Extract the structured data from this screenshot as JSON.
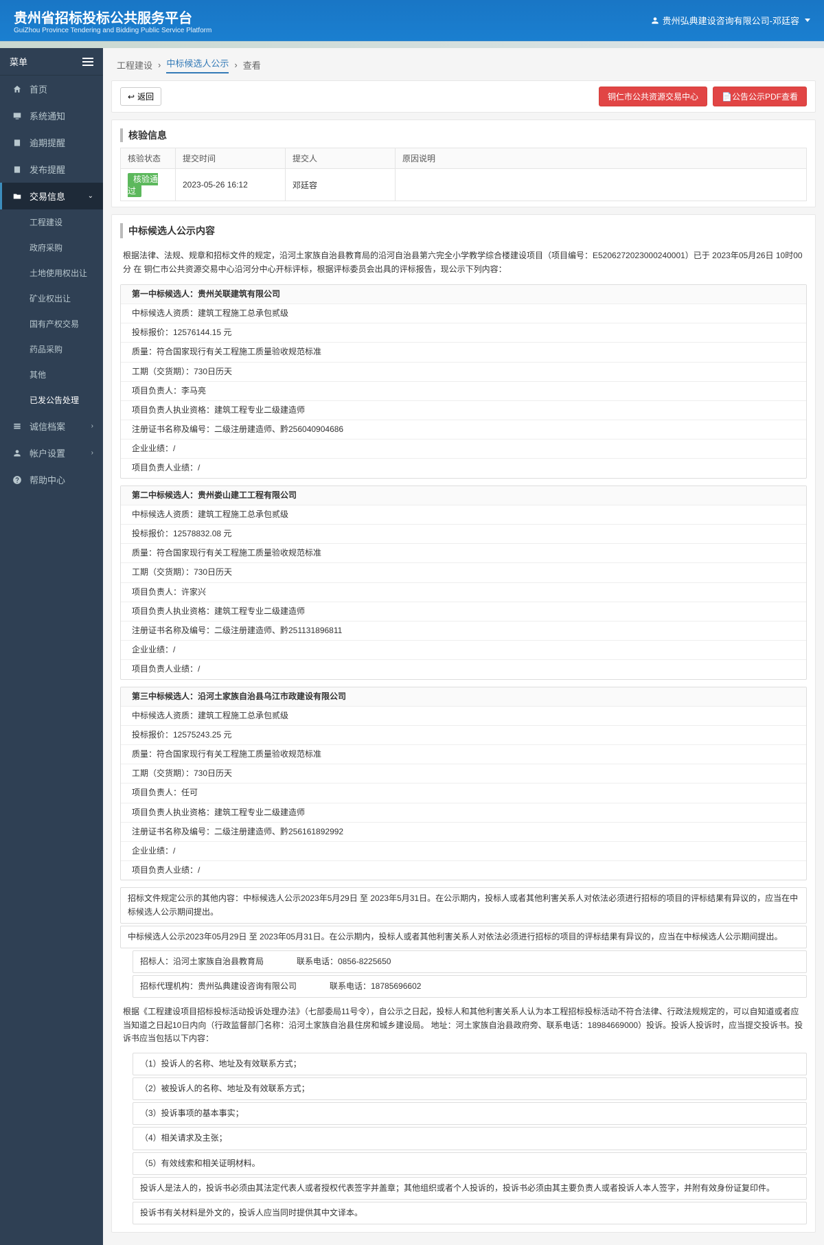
{
  "header": {
    "title_zh": "贵州省招标投标公共服务平台",
    "title_en": "GuiZhou Province Tendering and Bidding Public Service Platform",
    "user_label": "贵州弘典建设咨询有限公司-邓廷容"
  },
  "sidebar": {
    "menu_label": "菜单",
    "items": [
      {
        "label": "首页",
        "icon": "home-icon"
      },
      {
        "label": "系统通知",
        "icon": "monitor-icon"
      },
      {
        "label": "逾期提醒",
        "icon": "calendar-icon"
      },
      {
        "label": "发布提醒",
        "icon": "calendar-icon"
      },
      {
        "label": "交易信息",
        "icon": "folder-icon",
        "active": true,
        "expanded": true
      },
      {
        "label": "诚信档案",
        "icon": "list-icon",
        "chev": true
      },
      {
        "label": "帐户设置",
        "icon": "user-icon",
        "chev": true
      },
      {
        "label": "帮助中心",
        "icon": "help-icon"
      }
    ],
    "sub_items": [
      {
        "label": "工程建设"
      },
      {
        "label": "政府采购"
      },
      {
        "label": "土地使用权出让"
      },
      {
        "label": "矿业权出让"
      },
      {
        "label": "国有产权交易"
      },
      {
        "label": "药品采购"
      },
      {
        "label": "其他"
      },
      {
        "label": "已发公告处理",
        "current": true
      }
    ]
  },
  "breadcrumb": {
    "a": "工程建设",
    "b": "中标候选人公示",
    "c": "查看"
  },
  "toolbar": {
    "back": "返回",
    "center": "铜仁市公共资源交易中心",
    "pdf": "公告公示PDF查看"
  },
  "verify": {
    "section": "核验信息",
    "headers": {
      "status": "核验状态",
      "time": "提交时间",
      "person": "提交人",
      "reason": "原因说明"
    },
    "row": {
      "status": "核验通过",
      "time": "2023-05-26 16:12",
      "person": "邓廷容",
      "reason": ""
    }
  },
  "announcement": {
    "section": "中标候选人公示内容",
    "intro": "根据法律、法规、规章和招标文件的规定，沿河土家族自治县教育局的沿河自治县第六完全小学教学综合楼建设项目（项目编号：E5206272023000240001）已于 2023年05月26日 10时00分 在 铜仁市公共资源交易中心沿河分中心开标评标，根据评标委员会出具的评标报告，现公示下列内容：",
    "candidates": [
      {
        "head": "第一中标候选人：贵州关联建筑有限公司",
        "rows": [
          "中标候选人资质：建筑工程施工总承包贰级",
          "投标报价：12576144.15 元",
          "质量：符合国家现行有关工程施工质量验收规范标准",
          "工期（交货期）：730日历天",
          "项目负责人：李马亮",
          "项目负责人执业资格：建筑工程专业二级建造师",
          "注册证书名称及编号：二级注册建造师、黔256040904686",
          "企业业绩：/",
          "项目负责人业绩：/"
        ]
      },
      {
        "head": "第二中标候选人：贵州娄山建工工程有限公司",
        "rows": [
          "中标候选人资质：建筑工程施工总承包贰级",
          "投标报价：12578832.08 元",
          "质量：符合国家现行有关工程施工质量验收规范标准",
          "工期（交货期）：730日历天",
          "项目负责人：许家兴",
          "项目负责人执业资格：建筑工程专业二级建造师",
          "注册证书名称及编号：二级注册建造师、黔251131896811",
          "企业业绩：/",
          "项目负责人业绩：/"
        ]
      },
      {
        "head": "第三中标候选人：沿河土家族自治县乌江市政建设有限公司",
        "rows": [
          "中标候选人资质：建筑工程施工总承包贰级",
          "投标报价：12575243.25 元",
          "质量：符合国家现行有关工程施工质量验收规范标准",
          "工期（交货期）：730日历天",
          "项目负责人：任可",
          "项目负责人执业资格：建筑工程专业二级建造师",
          "注册证书名称及编号：二级注册建造师、黔256161892992",
          "企业业绩：/",
          "项目负责人业绩：/"
        ]
      }
    ],
    "footer": [
      "招标文件规定公示的其他内容：中标候选人公示2023年5月29日 至 2023年5月31日。在公示期内，投标人或者其他利害关系人对依法必须进行招标的项目的评标结果有异议的，应当在中标候选人公示期间提出。",
      "中标候选人公示2023年05月29日 至 2023年05月31日。在公示期内，投标人或者其他利害关系人对依法必须进行招标的项目的评标结果有异议的，应当在中标候选人公示期间提出。"
    ],
    "contacts": [
      "招标人：沿河土家族自治县教育局　　　　联系电话：0856-8225650",
      "招标代理机构：贵州弘典建设咨询有限公司　　　　联系电话：18785696602"
    ],
    "complaint_intro": "根据《工程建设项目招标投标活动投诉处理办法》（七部委局11号令），自公示之日起，投标人和其他利害关系人认为本工程招标投标活动不符合法律、行政法规规定的，可以自知道或者应当知道之日起10日内向（行政监督部门名称：沿河土家族自治县住房和城乡建设局。 地址：河土家族自治县政府旁、联系电话：18984669000）投诉。投诉人投诉时，应当提交投诉书。投诉书应当包括以下内容：",
    "complaint_items": [
      "（1）投诉人的名称、地址及有效联系方式；",
      "（2）被投诉人的名称、地址及有效联系方式；",
      "（3）投诉事项的基本事实；",
      "（4）相关请求及主张；",
      "（5）有效线索和相关证明材料。"
    ],
    "complaint_notes": [
      "投诉人是法人的，投诉书必须由其法定代表人或者授权代表签字并盖章；其他组织或者个人投诉的，投诉书必须由其主要负责人或者投诉人本人签字，并附有效身份证复印件。",
      "投诉书有关材料是外文的，投诉人应当同时提供其中文译本。"
    ]
  }
}
